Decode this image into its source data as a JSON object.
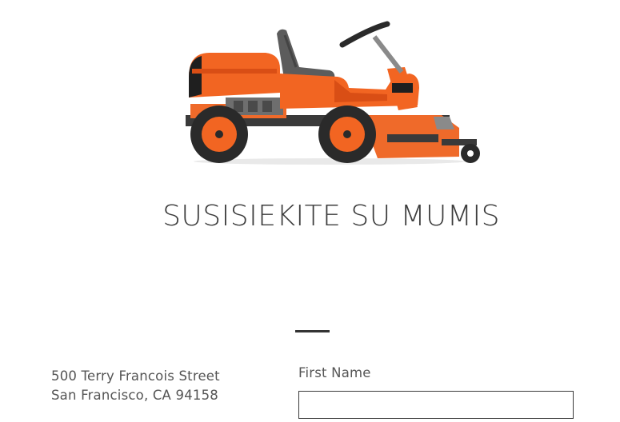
{
  "hero": {
    "icon": "riding-lawn-mower",
    "colors": {
      "body": "#f26522",
      "body_dark": "#d94e15",
      "seat": "#5c5c5c",
      "tire": "#2a2a2a",
      "metal": "#8a8a8a"
    }
  },
  "contact": {
    "title": "SUSISIEKITE SU MUMIS",
    "address_line1": "500 Terry Francois Street",
    "address_line2": "San Francisco, CA 94158"
  },
  "form": {
    "first_name_label": "First Name",
    "first_name_value": "",
    "first_name_placeholder": ""
  }
}
